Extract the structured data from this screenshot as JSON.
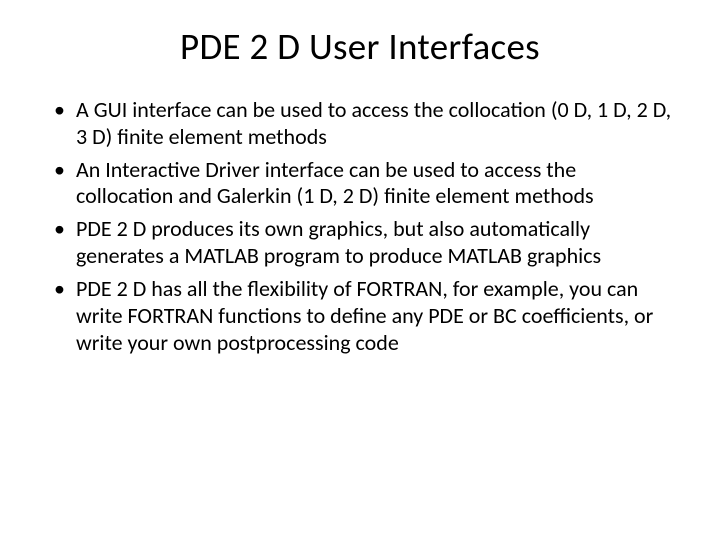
{
  "slide": {
    "title": "PDE 2 D User Interfaces",
    "bullets": [
      "A GUI interface can be used to access the collocation (0 D, 1 D, 2 D, 3 D) finite element methods",
      "An Interactive Driver interface can be used to access the collocation and Galerkin (1 D, 2 D) finite element methods",
      "PDE 2 D produces its own graphics, but also automatically generates a MATLAB program to produce MATLAB graphics",
      "PDE 2 D has all the flexibility of FORTRAN, for example, you can write FORTRAN functions to define any PDE or BC coefficients, or write your own postprocessing code"
    ]
  }
}
